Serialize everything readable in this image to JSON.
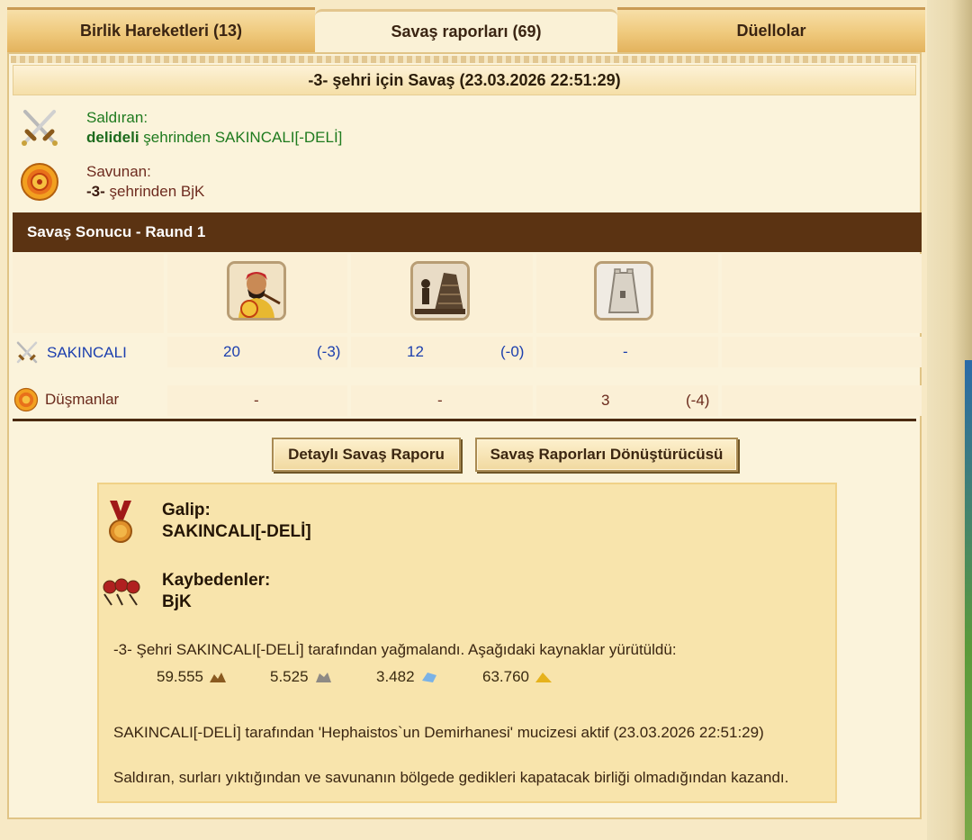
{
  "tabs": [
    {
      "label": "Birlik Hareketleri (13)"
    },
    {
      "label": "Savaş raporları (69)"
    },
    {
      "label": "Düellolar"
    }
  ],
  "report": {
    "title": "-3- şehri için Savaş (23.03.2026 22:51:29)",
    "attacker": {
      "heading": "Saldıran:",
      "city": "delideli",
      "suffix": " şehrinden SAKINCALI[-DELİ]"
    },
    "defender": {
      "heading": "Savunan:",
      "city": "-3-",
      "suffix": " şehrinden BjK"
    }
  },
  "battle": {
    "section_title": "Savaş Sonucu - Raund 1",
    "units": [
      "hoplite-unit",
      "catapult-unit",
      "wall-unit"
    ],
    "rows": [
      {
        "label": "SAKINCALI",
        "cells": [
          {
            "count": "20",
            "loss": "(-3)"
          },
          {
            "count": "12",
            "loss": "(-0)"
          },
          {
            "count": "-",
            "loss": ""
          }
        ]
      },
      {
        "label": "Düşmanlar",
        "cells": [
          {
            "count": "-",
            "loss": ""
          },
          {
            "count": "-",
            "loss": ""
          },
          {
            "count": "3",
            "loss": "(-4)"
          }
        ]
      }
    ]
  },
  "buttons": {
    "detailed": "Detaylı Savaş Raporu",
    "converter": "Savaş Raporları Dönüştürücüsü"
  },
  "result": {
    "winner_label": "Galip:",
    "winner_name": "SAKINCALI[-DELİ]",
    "losers_label": "Kaybedenler:",
    "losers_name": "BjK",
    "plunder_text": "-3- Şehri SAKINCALI[-DELİ] tarafından yağmalandı. Aşağıdaki kaynaklar yürütüldü:",
    "resources": [
      {
        "amount": "59.555",
        "icon": "wood-icon"
      },
      {
        "amount": "5.525",
        "icon": "stone-icon"
      },
      {
        "amount": "3.482",
        "icon": "crystal-icon"
      },
      {
        "amount": "63.760",
        "icon": "sulfur-icon"
      }
    ],
    "wonder_text": "SAKINCALI[-DELİ] tarafından 'Hephaistos`un Demirhanesi' mucizesi aktif (23.03.2026 22:51:29)",
    "reason_text": "Saldıran, surları yıktığından ve savunanın bölgede gedikleri kapatacak birliği olmadığından kazandı."
  },
  "colors": {
    "section_bar": "#5b3312",
    "attacker": "#1e7a1e",
    "defender": "#6e2b1f",
    "count_blue": "#1c3fae"
  }
}
